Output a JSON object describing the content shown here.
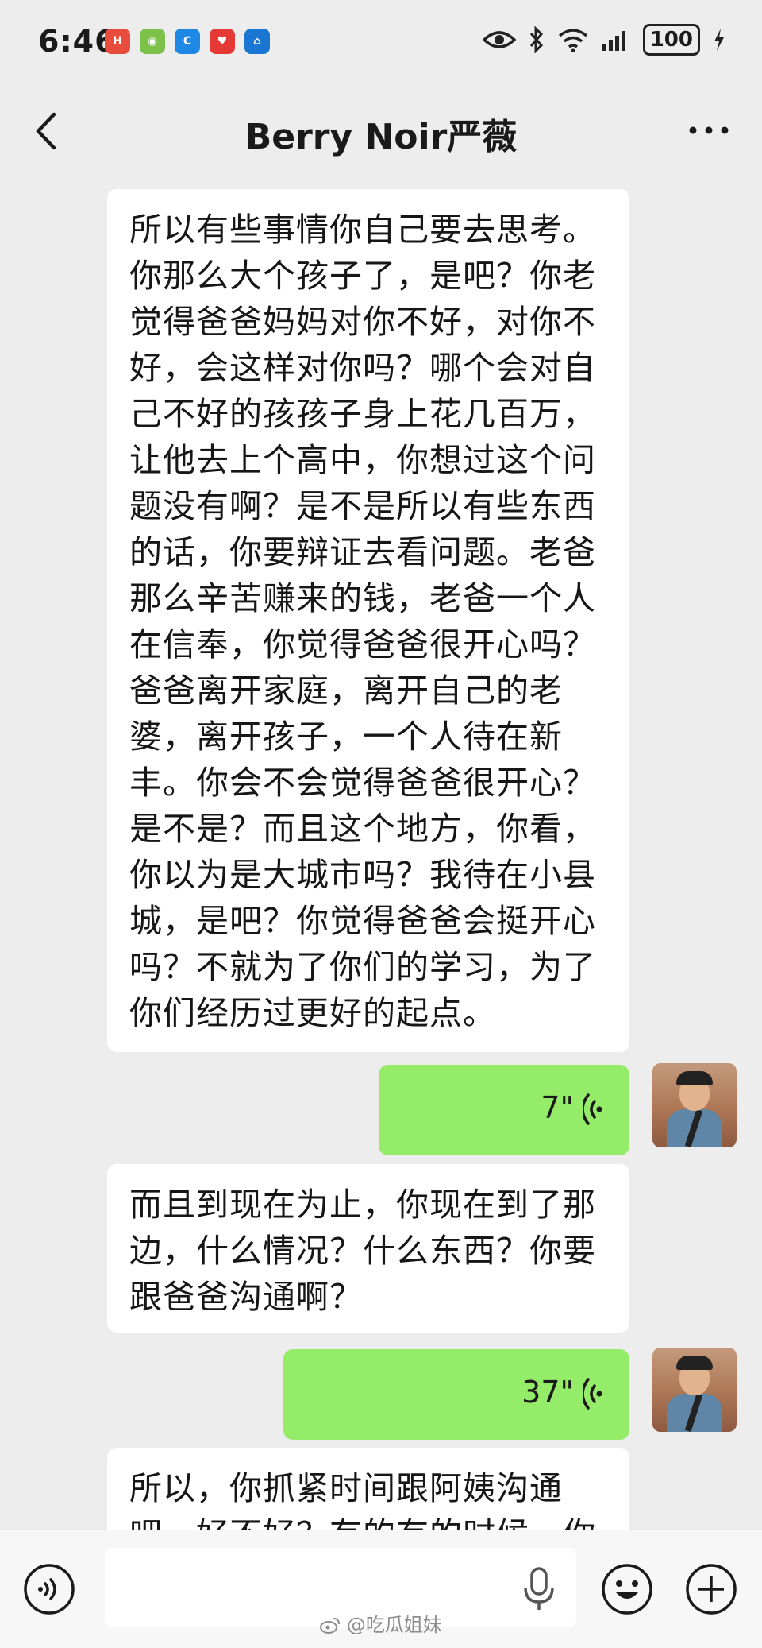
{
  "status_bar": {
    "time": "6:46",
    "battery": "100",
    "app_icons": [
      {
        "name": "huawei-app-icon",
        "color": "#e84c3d",
        "glyph": "H"
      },
      {
        "name": "shopping-app-icon",
        "color": "#7cc24a",
        "glyph": "◉"
      },
      {
        "name": "circle-app-icon",
        "color": "#1e88e5",
        "glyph": "C"
      },
      {
        "name": "heart-app-icon",
        "color": "#e53935",
        "glyph": "♥"
      },
      {
        "name": "house-app-icon",
        "color": "#1976d2",
        "glyph": "⌂"
      }
    ]
  },
  "header": {
    "title": "Berry Noir严薇"
  },
  "messages": [
    {
      "type": "incoming-text",
      "text": "所以有些事情你自己要去思考。\n你那么大个孩子了，是吧？你老\n觉得爸爸妈妈对你不好，对你不\n好，会这样对你吗？哪个会对自\n己不好的孩孩子身上花几百万，\n让他去上个高中，你想过这个问\n题没有啊？是不是所以有些东西\n的话，你要辩证去看问题。老爸\n那么辛苦赚来的钱，老爸一个人\n在信奉，你觉得爸爸很开心吗？\n爸爸离开家庭，离开自己的老\n婆，离开孩子，一个人待在新\n丰。你会不会觉得爸爸很开心？\n是不是？而且这个地方，你看，\n你以为是大城市吗？我待在小县\n城，是吧？你觉得爸爸会挺开心\n吗？不就为了你们的学习，为了\n你们经历过更好的起点。"
    },
    {
      "type": "outgoing-voice",
      "duration": "7\""
    },
    {
      "type": "incoming-text",
      "text": "而且到现在为止，你现在到了那\n边，什么情况？什么东西？你要\n跟爸爸沟通啊？"
    },
    {
      "type": "outgoing-voice",
      "duration": "37\""
    },
    {
      "type": "incoming-text",
      "text": "所以，你抓紧时间跟阿姨沟通\n吧，好不好？有的有的时候，你"
    }
  ],
  "input_bar": {
    "placeholder": ""
  },
  "watermark": "@吃瓜姐妹",
  "colors": {
    "background": "#ededed",
    "incoming_bubble": "#ffffff",
    "outgoing_bubble": "#95ec69"
  }
}
